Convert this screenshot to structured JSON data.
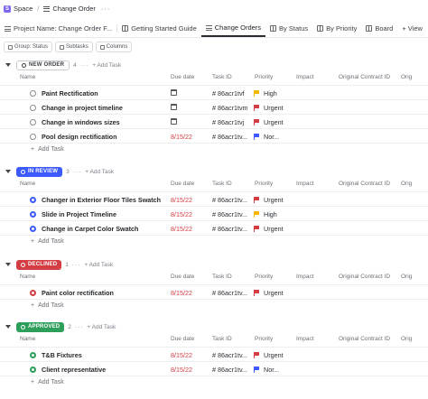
{
  "breadcrumb": {
    "space_initial": "S",
    "space": "Space",
    "separator": "/",
    "list": "Change Order",
    "more": "···"
  },
  "tabs": [
    {
      "label": "Project Name: Change Order F..."
    },
    {
      "label": "Getting Started Guide"
    },
    {
      "label": "Change Orders",
      "active": true
    },
    {
      "label": "By Status"
    },
    {
      "label": "By Priority"
    },
    {
      "label": "Board"
    },
    {
      "label": "+ View"
    }
  ],
  "toolbar": {
    "group": "Group: Status",
    "subtasks": "Subtasks",
    "columns": "Columns"
  },
  "columns": [
    "Name",
    "Due date",
    "Task ID",
    "Priority",
    "Impact",
    "Original Contract ID",
    "Orig"
  ],
  "add_task_label": "+ Add Task",
  "add_task_row_label": "Add Task",
  "groups": [
    {
      "status": "NEW ORDER",
      "count": "4",
      "dots": "···",
      "color": "#ffffff",
      "text_color": "#3a3d42",
      "border": "#c8cbd0",
      "tasks": [
        {
          "name": "Paint Rectification",
          "due": "",
          "id": "# 86acr1tvf",
          "priority": "High",
          "priority_color": "#f5b700"
        },
        {
          "name": "Change in project timeline",
          "due": "",
          "id": "# 86acr1tvm",
          "priority": "Urgent",
          "priority_color": "#d33d44"
        },
        {
          "name": "Change in windows sizes",
          "due": "",
          "id": "# 86acr1tvj",
          "priority": "Urgent",
          "priority_color": "#d33d44"
        },
        {
          "name": "Pool design rectification",
          "due": "8/15/22",
          "id": "# 86acr1tv...",
          "priority": "Nor...",
          "priority_color": "#3d5afe"
        }
      ]
    },
    {
      "status": "IN REVIEW",
      "count": "3",
      "dots": "···",
      "color": "#3d5afe",
      "text_color": "#ffffff",
      "tasks": [
        {
          "name": "Changer in Exterior Floor Tiles Swatch",
          "due": "8/15/22",
          "id": "# 86acr1tv...",
          "priority": "Urgent",
          "priority_color": "#d33d44"
        },
        {
          "name": "Slide in Project Timeline",
          "due": "8/15/22",
          "id": "# 86acr1tv...",
          "priority": "High",
          "priority_color": "#f5b700"
        },
        {
          "name": "Change in Carpet Color Swatch",
          "due": "8/15/22",
          "id": "# 86acr1tv...",
          "priority": "Urgent",
          "priority_color": "#d33d44"
        }
      ]
    },
    {
      "status": "DECLINED",
      "count": "1",
      "dots": "···",
      "color": "#d33d44",
      "text_color": "#ffffff",
      "tasks": [
        {
          "name": "Paint color rectification",
          "due": "8/15/22",
          "id": "# 86acr1tv...",
          "priority": "Urgent",
          "priority_color": "#d33d44"
        }
      ]
    },
    {
      "status": "APPROVED",
      "count": "2",
      "dots": "···",
      "color": "#2e9e5b",
      "text_color": "#ffffff",
      "tasks": [
        {
          "name": "T&B Fixtures",
          "due": "8/15/22",
          "id": "# 86acr1tv...",
          "priority": "Urgent",
          "priority_color": "#d33d44"
        },
        {
          "name": "Client representative",
          "due": "8/15/22",
          "id": "# 86acr1tv...",
          "priority": "Nor...",
          "priority_color": "#3d5afe"
        }
      ]
    }
  ]
}
